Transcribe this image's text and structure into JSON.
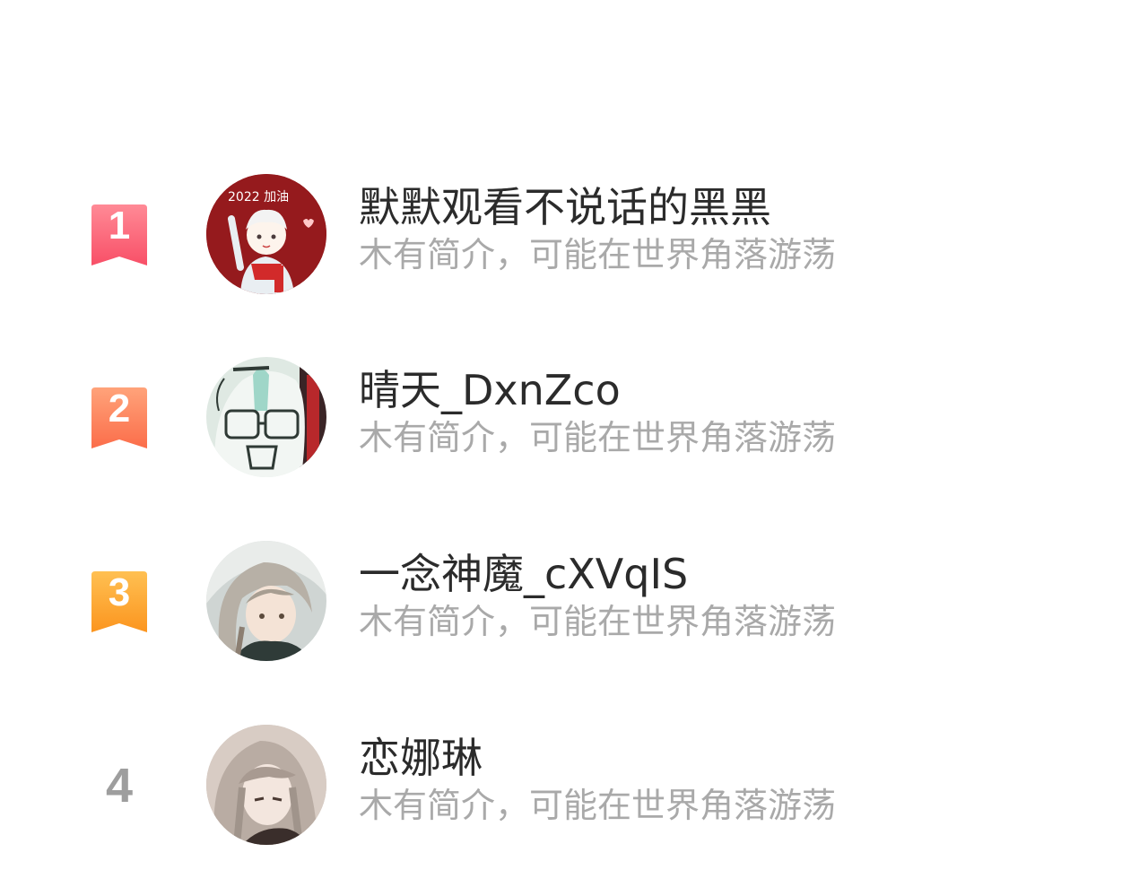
{
  "ranking": [
    {
      "rank": "1",
      "badge_colors": [
        "#ff8a96",
        "#f84f67"
      ],
      "name": "默默观看不说话的黑黑",
      "bio": "木有简介，可能在世界角落游荡",
      "avatar_caption": "2022 加油"
    },
    {
      "rank": "2",
      "badge_colors": [
        "#ffa37a",
        "#fb6d4a"
      ],
      "name": "晴天_DxnZco",
      "bio": "木有简介，可能在世界角落游荡"
    },
    {
      "rank": "3",
      "badge_colors": [
        "#ffc052",
        "#fb951f"
      ],
      "name": "一念神魔_cXVqIS",
      "bio": "木有简介，可能在世界角落游荡"
    },
    {
      "rank": "4",
      "name": "恋娜琳",
      "bio": "木有简介，可能在世界角落游荡"
    }
  ],
  "colors": {
    "name_text": "#2b2b2b",
    "bio_text": "#a9a9a9",
    "plain_rank": "#9e9e9e"
  }
}
